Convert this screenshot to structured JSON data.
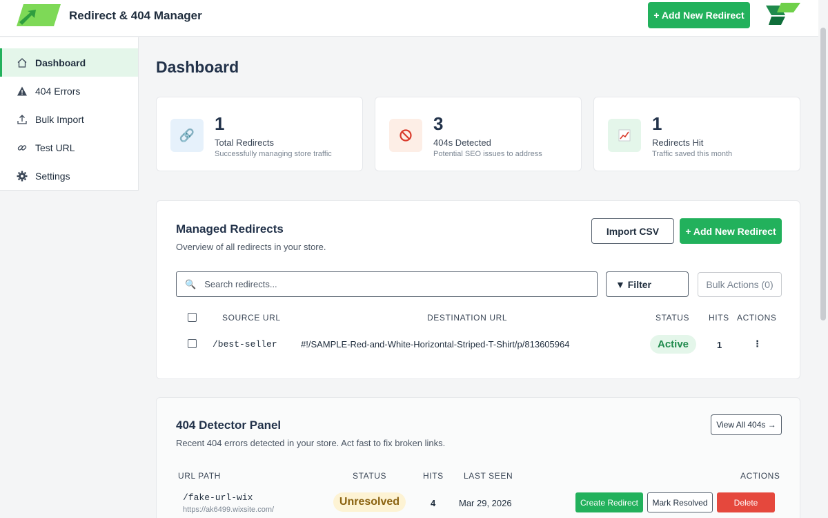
{
  "header": {
    "app_title": "Redirect & 404 Manager",
    "add_button": "+ Add New Redirect"
  },
  "sidebar": {
    "items": [
      {
        "label": "Dashboard",
        "icon": "home-icon",
        "active": true
      },
      {
        "label": "404 Errors",
        "icon": "warning-icon",
        "active": false
      },
      {
        "label": "Bulk Import",
        "icon": "upload-icon",
        "active": false
      },
      {
        "label": "Test URL",
        "icon": "link-icon",
        "active": false
      },
      {
        "label": "Settings",
        "icon": "gear-icon",
        "active": false
      }
    ]
  },
  "page_title": "Dashboard",
  "stats": [
    {
      "value": "1",
      "label": "Total Redirects",
      "sub": "Successfully managing store traffic",
      "icon": "link-icon"
    },
    {
      "value": "3",
      "label": "404s Detected",
      "sub": "Potential SEO issues to address",
      "icon": "prohibited-icon"
    },
    {
      "value": "1",
      "label": "Redirects Hit",
      "sub": "Traffic saved this month",
      "icon": "chart-up-icon"
    }
  ],
  "managed": {
    "title": "Managed Redirects",
    "subtitle": "Overview of all redirects in your store.",
    "import_button": "Import CSV",
    "add_button": "+ Add New Redirect",
    "search_placeholder": "Search redirects...",
    "filter_button": "Filter",
    "bulk_button": "Bulk Actions (0)",
    "columns": {
      "source": "SOURCE URL",
      "destination": "DESTINATION URL",
      "status": "STATUS",
      "hits": "HITS",
      "actions": "ACTIONS"
    },
    "rows": [
      {
        "source": "/best-seller",
        "destination": "#!/SAMPLE-Red-and-White-Horizontal-Striped-T-Shirt/p/813605964",
        "status": "Active",
        "hits": "1",
        "actions": "⋮"
      }
    ]
  },
  "detector": {
    "title": "404 Detector Panel",
    "subtitle": "Recent 404 errors detected in your store. Act fast to fix broken links.",
    "view_all": "View All 404s →",
    "columns": {
      "path": "URL PATH",
      "status": "STATUS",
      "hits": "HITS",
      "last_seen": "LAST SEEN",
      "actions": "ACTIONS"
    },
    "rows": [
      {
        "path": "/fake-url-wix",
        "site": "https://ak6499.wixsite.com/",
        "status": "Unresolved",
        "hits": "4",
        "last_seen": "Mar 29, 2026",
        "create": "Create Redirect",
        "resolve": "Mark Resolved",
        "delete": "Delete"
      }
    ]
  },
  "colors": {
    "accent": "#22b15c",
    "danger": "#e5483d",
    "active_badge_bg": "#e4f6ea",
    "unresolved_badge_bg": "#fdf3d4"
  }
}
